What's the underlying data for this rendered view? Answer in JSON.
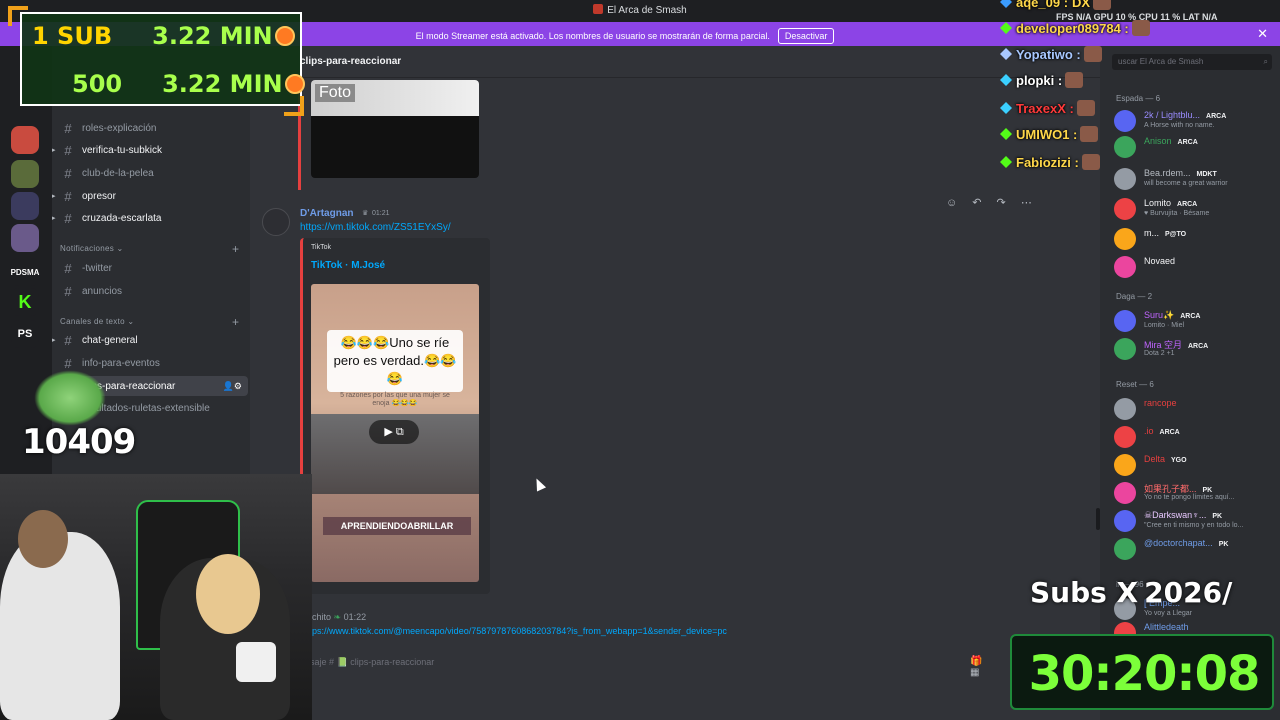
{
  "window": {
    "title": "El Arca de Smash"
  },
  "banner": {
    "message": "El modo Streamer está activado. Los nombres de usuario se mostrarán de forma parcial.",
    "button": "Desactivar",
    "close": "✕"
  },
  "server": {
    "name": "El Arca de Smash"
  },
  "rail": {
    "servers": [
      "K",
      "PS",
      "PDSMA"
    ]
  },
  "sidebar": {
    "channels_top": [
      "roles-explicación",
      "verifica-tu-subkick",
      "club-de-la-pelea",
      "opresor",
      "cruzada-escarlata"
    ],
    "cat_notif": "Notificaciones",
    "notif_channels": [
      "-twitter",
      "anuncios"
    ],
    "cat_text": "Canales de texto",
    "text_channels": [
      "chat-general",
      "info-para-eventos",
      "clips-para-reaccionar",
      "resultados-ruletas-extensible"
    ]
  },
  "chat": {
    "channel_name": "clips-para-reaccionar",
    "foto_label": "Foto",
    "msg1": {
      "author": "D'Artagnan",
      "time": "01:21",
      "link": "https://vm.tiktok.com/ZS51EYxSy/",
      "embed_provider": "TikTok",
      "embed_title": "TikTok · M.José",
      "caption": "😂😂😂Uno se ríe pero es verdad.😂😂😂",
      "subcaption": "5 razones por las que una mujer se enoja 😂😂😂",
      "logo": "APRENDIENDOABRILLAR"
    },
    "msg2": {
      "author": "chito",
      "time": "01:22",
      "link": "ps://www.tiktok.com/@meencapo/video/7587978760868203784?is_from_webapp=1&sender_device=pc"
    },
    "composer_placeholder": "saje # 📗 clips-para-reaccionar"
  },
  "members": {
    "search_placeholder": "uscar El Arca de Smash",
    "groups": [
      {
        "label": "Espada — 6"
      },
      {
        "label": "Daga — 2"
      },
      {
        "label": "Reset — 6"
      },
      {
        "label": "in — 96"
      }
    ],
    "list": [
      {
        "name": "2k / Lightblu...",
        "tag": "ARCA",
        "status": "A Horse with no name.",
        "color": "#9a8cff"
      },
      {
        "name": "Anison",
        "tag": "ARCA",
        "status": "",
        "color": "#3ba55c"
      },
      {
        "name": "Bea.rdem...",
        "tag": "MDKT",
        "status": "will become a great warrior",
        "color": "#b5bac1"
      },
      {
        "name": "Lomito",
        "tag": "ARCA",
        "status": "♥ Burvujita · Bésame",
        "color": "#f2f3f5"
      },
      {
        "name": "m...",
        "tag": "P@TO",
        "status": "",
        "color": "#f2f3f5"
      },
      {
        "name": "Novaed",
        "tag": "",
        "status": "",
        "color": "#f2f3f5"
      },
      {
        "name": "Suru✨",
        "tag": "ARCA",
        "status": "Lomito · Miel",
        "color": "#c064ff"
      },
      {
        "name": "Mira 空月",
        "tag": "ARCA",
        "status": "Dota 2 +1",
        "color": "#c064ff"
      },
      {
        "name": "rancope",
        "tag": "",
        "status": "",
        "color": "#e5403f"
      },
      {
        "name": ".io",
        "tag": "ARCA",
        "status": "",
        "color": "#e5403f"
      },
      {
        "name": "Delta",
        "tag": "YGO",
        "status": "",
        "color": "#e5403f"
      },
      {
        "name": "如果孔子都...",
        "tag": "PK",
        "status": "Yo no te pongo límites aquí...",
        "color": "#ff6b6b"
      },
      {
        "name": "☠Darkswan♆...",
        "tag": "PK",
        "status": "\"Cree en ti mismo y en todo lo...",
        "color": "#e8c8ff"
      },
      {
        "name": "@doctorchapat...",
        "tag": "PK",
        "status": "",
        "color": "#6f9ce8"
      },
      {
        "name": "[ Empe...",
        "tag": "",
        "status": "Yo voy a Llegar",
        "color": "#6f9ce8"
      },
      {
        "name": "Alittledeath",
        "tag": "",
        "status": "",
        "color": "#6f9ce8"
      }
    ]
  },
  "overlay": {
    "goal1_left": "1 SUB",
    "goal1_right": "3.22 MIN",
    "goal2_left": "500",
    "goal2_right": "3.22 MIN",
    "counter": "10409",
    "chat": [
      {
        "user": "aqe_09 :",
        "msg": "DX",
        "color": "#ffd84a"
      },
      {
        "user": "developer089784 :",
        "msg": "",
        "color": "#ffd84a"
      },
      {
        "user": "Yopatiwo :",
        "msg": "",
        "color": "#a8c8ff"
      },
      {
        "user": "plopki :",
        "msg": "",
        "color": "#ffffff"
      },
      {
        "user": "TraxexX :",
        "msg": "",
        "color": "#ff3a3a"
      },
      {
        "user": "UMIWO1 :",
        "msg": "",
        "color": "#ffd84a"
      },
      {
        "user": "Fabiozizi :",
        "msg": "",
        "color": "#ffd84a"
      }
    ],
    "stats": "FPS N/A   GPU 10 %   CPU 11 %   LAT N/A",
    "subs_label": "Subs X",
    "subs_date": "2026/",
    "timer": "30:20:08"
  }
}
